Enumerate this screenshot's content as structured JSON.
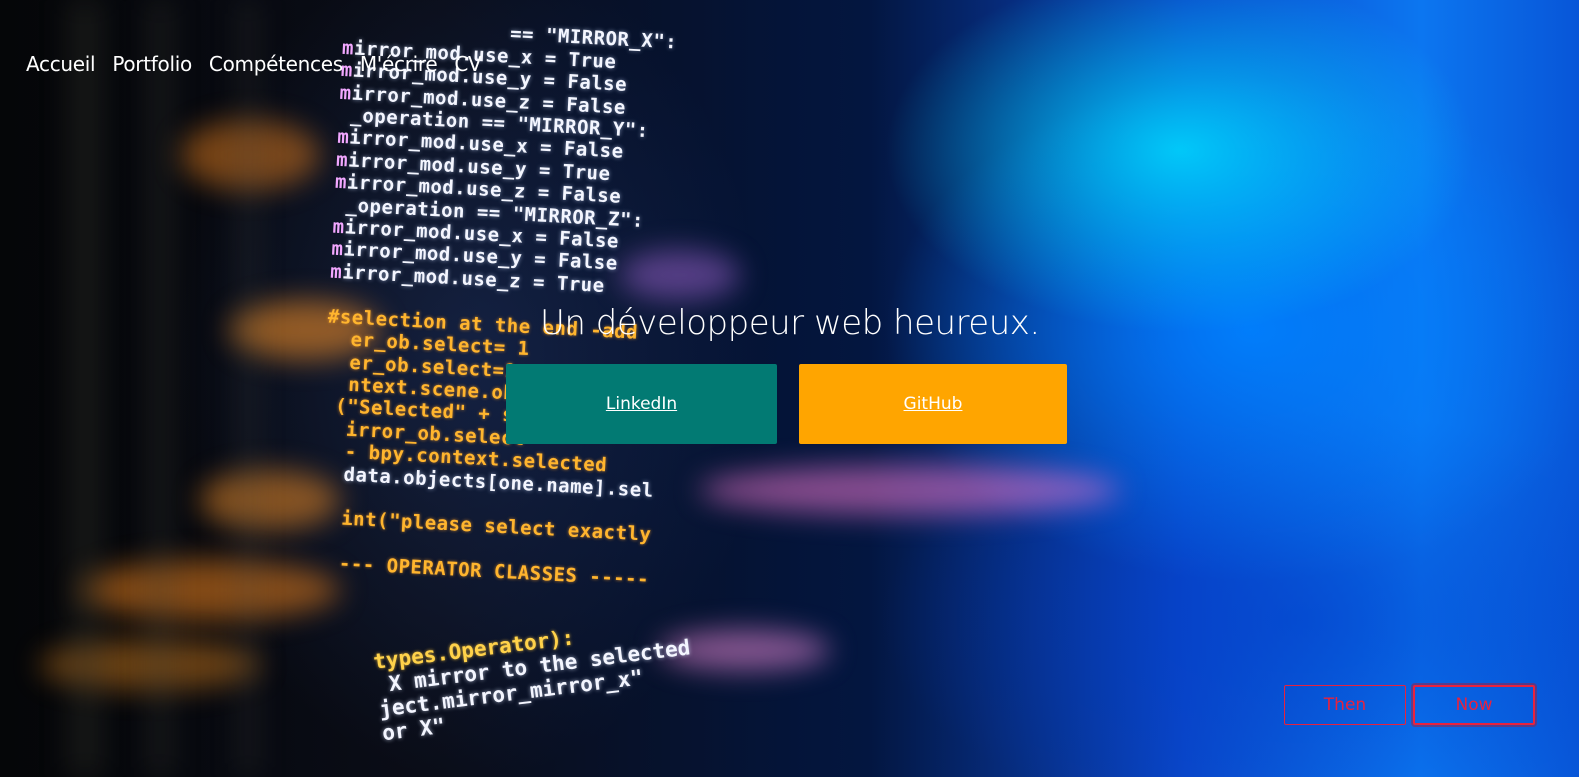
{
  "nav": {
    "items": [
      {
        "label": "Accueil"
      },
      {
        "label": "Portfolio"
      },
      {
        "label": "Compétences"
      },
      {
        "label": "M'écrire"
      },
      {
        "label": "CV"
      }
    ]
  },
  "hero": {
    "tagline": "Un développeur web heureux.",
    "buttons": {
      "linkedin": "LinkedIn",
      "github": "GitHub"
    },
    "background_code": {
      "top_lines": [
        {
          "prefix": "",
          "text": "              == \"MIRROR_X\":"
        },
        {
          "prefix": "m",
          "text": "irror_mod.use_x = True"
        },
        {
          "prefix": "m",
          "text": "irror_mod.use_y = False"
        },
        {
          "prefix": "m",
          "text": "irror_mod.use_z = False"
        },
        {
          "prefix": "",
          "text": " _operation == \"MIRROR_Y\":"
        },
        {
          "prefix": "m",
          "text": "irror_mod.use_x = False"
        },
        {
          "prefix": "m",
          "text": "irror_mod.use_y = True"
        },
        {
          "prefix": "m",
          "text": "irror_mod.use_z = False"
        },
        {
          "prefix": "",
          "text": " _operation == \"MIRROR_Z\":"
        },
        {
          "prefix": "m",
          "text": "irror_mod.use_x = False"
        },
        {
          "prefix": "m",
          "text": "irror_mod.use_y = False"
        },
        {
          "prefix": "m",
          "text": "irror_mod.use_z = True"
        }
      ],
      "mid_lines": [
        "#selection at the end -add",
        "  er_ob.select= 1",
        "  er_ob.select=1",
        "  ntext.scene.objects",
        " (\"Selected\" + str(",
        "  irror_ob.select",
        "  - bpy.context.selected",
        "  data.objects[one.name].sel",
        "",
        "  int(\"please select exactly",
        "",
        "  --- OPERATOR CLASSES -----"
      ],
      "bottom_lines": [
        "types.Operator):",
        " X mirror to the selected",
        "ject.mirror_mirror_x\"",
        "or X\""
      ]
    }
  },
  "toggle": {
    "then": "Then",
    "now": "Now"
  },
  "colors": {
    "linkedin": "#027a73",
    "github": "#ffa500",
    "toggle_accent": "#e8223e"
  }
}
